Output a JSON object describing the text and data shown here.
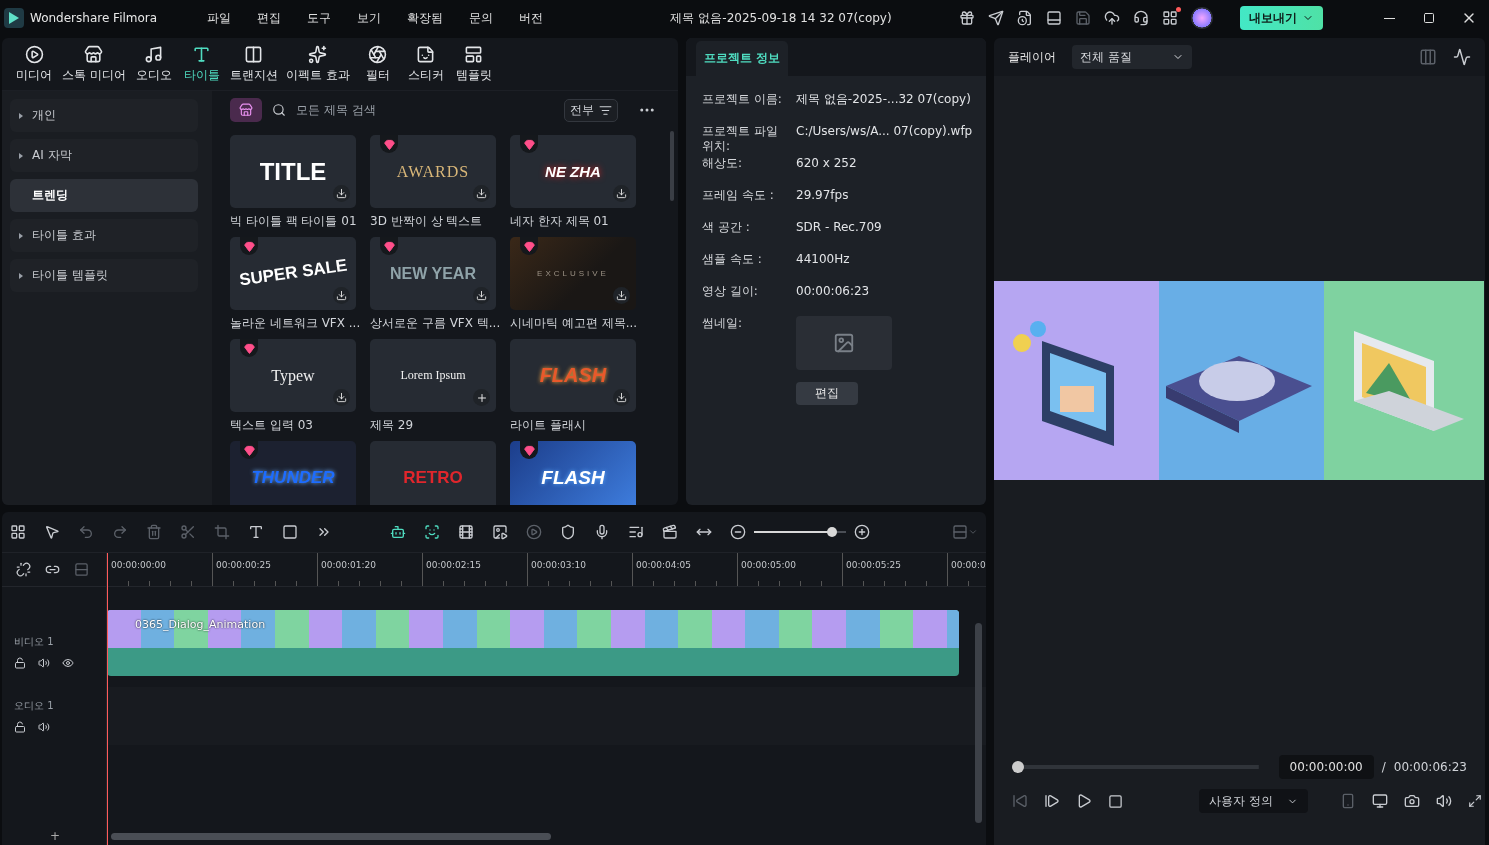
{
  "app": {
    "name": "Wondershare Filmora"
  },
  "menu": [
    "파일",
    "편집",
    "도구",
    "보기",
    "확장됨",
    "문의",
    "버전"
  ],
  "window": {
    "title": "제목 없음-2025-09-18 14 32 07(copy)"
  },
  "export_button": {
    "label": "내보내기"
  },
  "media_tabs": [
    {
      "label": "미디어",
      "kind": "media",
      "selected": false
    },
    {
      "label": "스톡 미디어",
      "kind": "stock",
      "selected": false
    },
    {
      "label": "오디오",
      "kind": "audio",
      "selected": false
    },
    {
      "label": "타이틀",
      "kind": "title",
      "selected": true
    },
    {
      "label": "트랜지션",
      "kind": "transition",
      "selected": false
    },
    {
      "label": "이펙트 효과",
      "kind": "effect",
      "selected": false
    },
    {
      "label": "필터",
      "kind": "filter",
      "selected": false
    },
    {
      "label": "스티커",
      "kind": "sticker",
      "selected": false
    },
    {
      "label": "템플릿",
      "kind": "template",
      "selected": false
    }
  ],
  "sidebar": {
    "items": [
      {
        "label": "개인",
        "expandable": true,
        "selected": false
      },
      {
        "label": "AI 자막",
        "expandable": true,
        "selected": false
      },
      {
        "label": "트렌딩",
        "expandable": false,
        "selected": true
      },
      {
        "label": "타이틀 효과",
        "expandable": true,
        "selected": false
      },
      {
        "label": "타이틀 템플릿",
        "expandable": true,
        "selected": false
      }
    ]
  },
  "search": {
    "placeholder": "모든 제목 검색"
  },
  "filter": {
    "label": "전부"
  },
  "titles": [
    {
      "label": "빅 타이틀 팩 타이틀 01",
      "preview": "TITLE",
      "kind": "bold",
      "premium": false,
      "download": true,
      "add": false
    },
    {
      "label": "3D 반짝이 상 텍스트",
      "preview": "AWARDS",
      "kind": "gold",
      "premium": true,
      "download": true,
      "add": false
    },
    {
      "label": "네자 한자 제목 01",
      "preview": "NE ZHA",
      "kind": "red",
      "premium": true,
      "download": true,
      "add": false
    },
    {
      "label": "놀라운 네트워크 VFX ...",
      "preview": "SUPER SALE",
      "kind": "blue",
      "premium": true,
      "download": true,
      "add": false
    },
    {
      "label": "상서로운 구름 VFX 텍...",
      "preview": "NEW YEAR",
      "kind": "grey",
      "premium": true,
      "download": true,
      "add": false
    },
    {
      "label": "시네마틱 예고편 제목...",
      "preview": "EXCLUSIVE",
      "kind": "cinema",
      "premium": true,
      "download": true,
      "add": false
    },
    {
      "label": "텍스트 입력 03",
      "preview": "Typew",
      "kind": "serif",
      "premium": true,
      "download": true,
      "add": false
    },
    {
      "label": "제목 29",
      "preview": "Lorem Ipsum",
      "kind": "serif",
      "premium": false,
      "download": false,
      "add": true
    },
    {
      "label": "라이트 플래시",
      "preview": "FLASH",
      "kind": "fire",
      "premium": false,
      "download": true,
      "add": false
    },
    {
      "preview": "THUNDER",
      "kind": "neon",
      "premium": true,
      "download": false,
      "add": false
    },
    {
      "preview": "RETRO",
      "kind": "retro",
      "premium": false,
      "download": false,
      "add": false
    },
    {
      "preview": "FLASH",
      "kind": "storm",
      "premium": true,
      "download": false,
      "add": false
    }
  ],
  "project_info": {
    "tab": {
      "label": "프로젝트 정보",
      "selected": true
    },
    "fields": [
      {
        "label": "프로젝트 이름:",
        "value": "제목 없음-2025-...32 07(copy)"
      },
      {
        "label": "프로젝트 파일 위치:",
        "value": "C:/Users/ws/A... 07(copy).wfp"
      },
      {
        "label": "해상도:",
        "value": "620 x 252"
      },
      {
        "label": "프레임 속도 :",
        "value": "29.97fps"
      },
      {
        "label": "색 공간 :",
        "value": "SDR - Rec.709"
      },
      {
        "label": "샘플 속도 :",
        "value": "44100Hz"
      },
      {
        "label": "영상 길이:",
        "value": "00:00:06:23"
      }
    ],
    "thumbnail_label": "썸네일:",
    "edit_button": "편집"
  },
  "player": {
    "tab": "플레이어",
    "quality": "전체 품질",
    "scrubber": {
      "level": 0
    },
    "current_time": "00:00:00:00",
    "separator": "/",
    "total_time": "00:00:06:23",
    "speed": "사용자 정의"
  },
  "timeline": {
    "zoom": {
      "level": 0.85
    },
    "ruler": [
      "00:00:00:00",
      "00:00:00:25",
      "00:00:01:20",
      "00:00:02:15",
      "00:00:03:10",
      "00:00:04:05",
      "00:00:05:00",
      "00:00:05:25",
      "00:00:0"
    ],
    "tracks": [
      {
        "kind": "video",
        "label": "비디오",
        "number": "1",
        "clip": "0365_Dialog_Animation"
      },
      {
        "kind": "audio",
        "label": "오디오",
        "number": "1"
      }
    ],
    "add_track": "+"
  }
}
